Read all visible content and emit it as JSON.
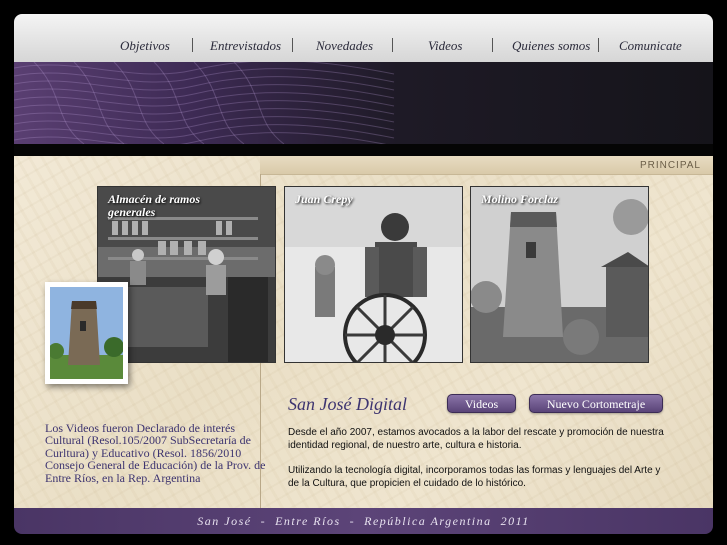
{
  "nav": {
    "items": [
      "Objetivos",
      "Entrevistados",
      "Novedades",
      "Videos",
      "Quienes somos",
      "Comunicate"
    ]
  },
  "section_label": "PRINCIPAL",
  "photos": {
    "almacen": "Almacén de ramos generales",
    "crepy": "Juan Crepy",
    "molino": "Molino Forclaz"
  },
  "notice": "Los Videos fueron Declarado de interés Cultural (Resol.105/2007 SubSecretaría de Curltura) y Educativo (Resol. 1856/2010 Consejo General de Educación) de la Prov. de Entre Ríos, en la Rep. Argentina",
  "main": {
    "title": "San José Digital",
    "videos_button": "Videos",
    "cortometraje_button": "Nuevo Cortometraje",
    "paragraph1": "Desde el año 2007, estamos avocados a la labor del rescate y promoción de nuestra identidad regional, de nuestro arte, cultura e historia.",
    "paragraph2": "Utilizando la tecnología digital, incorporamos todas las formas y lenguajes del Arte y de la Cultura, que propicien el cuidado de lo histórico."
  },
  "footer": "San José  -  Entre Ríos  -  República Argentina  2011",
  "colors": {
    "accent_purple": "#5a4478",
    "text_purple": "#3d3470",
    "nav_bg": "#e6e6e6"
  }
}
